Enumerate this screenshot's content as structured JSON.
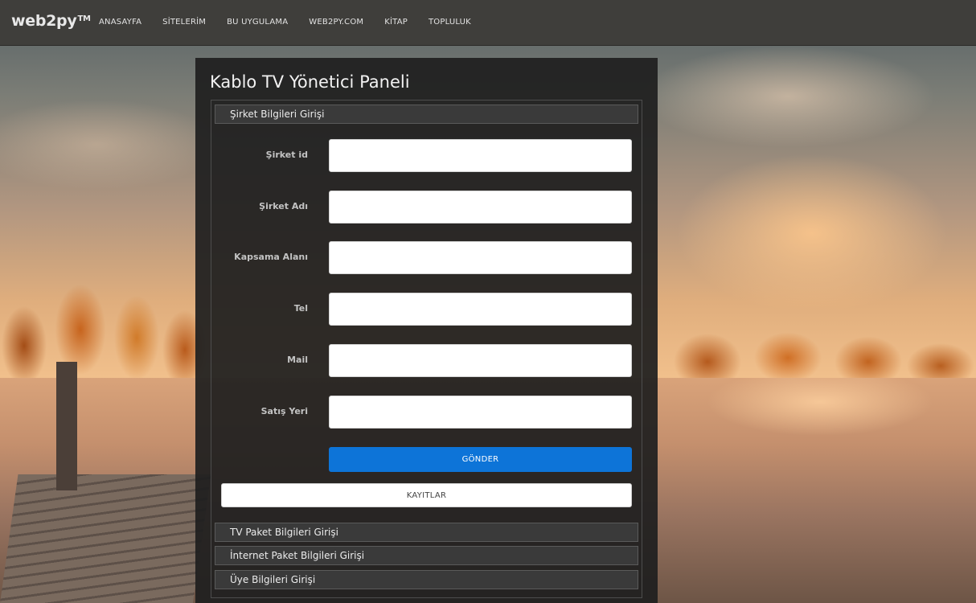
{
  "brand": {
    "name": "web2py",
    "tm": "TM"
  },
  "nav": {
    "items": [
      {
        "label": "ANASAYFA"
      },
      {
        "label": "SİTELERİM"
      },
      {
        "label": "BU UYGULAMA"
      },
      {
        "label": "WEB2PY.COM"
      },
      {
        "label": "KİTAP"
      },
      {
        "label": "TOPLULUK"
      }
    ]
  },
  "panel": {
    "title": "Kablo TV Yönetici Paneli",
    "sections": [
      {
        "label": "Şirket Bilgileri Girişi"
      },
      {
        "label": "TV Paket Bilgileri Girişi"
      },
      {
        "label": "İnternet Paket Bilgileri Girişi"
      },
      {
        "label": "Üye Bilgileri Girişi"
      }
    ],
    "form": {
      "fields": [
        {
          "label": "Şirket id",
          "value": ""
        },
        {
          "label": "Şirket Adı",
          "value": ""
        },
        {
          "label": "Kapsama Alanı",
          "value": ""
        },
        {
          "label": "Tel",
          "value": ""
        },
        {
          "label": "Mail",
          "value": ""
        },
        {
          "label": "Satış Yeri",
          "value": ""
        }
      ],
      "submit_label": "GÖNDER",
      "records_label": "KAYITLAR"
    }
  },
  "colors": {
    "navbar": "#3f3e3b",
    "panel": "#1f1f1f",
    "primary_button": "#0d74d8"
  }
}
